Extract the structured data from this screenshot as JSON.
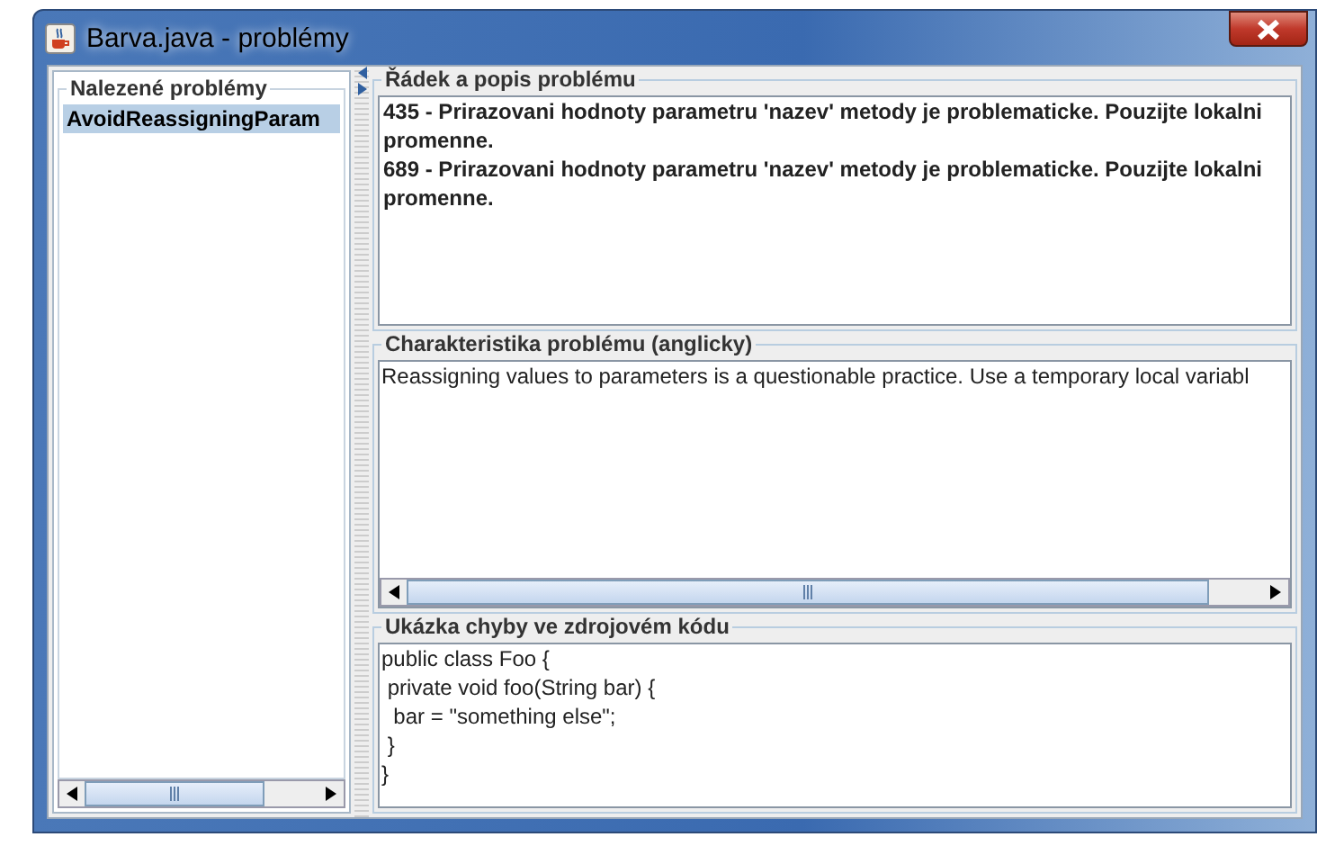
{
  "window": {
    "title": "Barva.java - problémy"
  },
  "problems_list": {
    "title": "Nalezené problémy",
    "items": [
      {
        "label": "AvoidReassigningParam",
        "selected": true
      }
    ]
  },
  "problem_lines": {
    "title": "Řádek a popis problému",
    "items": [
      "435 - Prirazovani hodnoty parametru 'nazev' metody je problematicke. Pouzijte lokalni promenne.",
      "689 - Prirazovani hodnoty parametru 'nazev' metody je problematicke. Pouzijte lokalni promenne."
    ]
  },
  "description": {
    "title": "Charakteristika problému (anglicky)",
    "text": "Reassigning values to parameters is a questionable practice.  Use a temporary local variabl"
  },
  "code_sample": {
    "title": "Ukázka chyby ve zdrojovém kódu",
    "lines": [
      "public class Foo {",
      " private void foo(String bar) {",
      "  bar = \"something else\";",
      " }",
      "}"
    ]
  }
}
